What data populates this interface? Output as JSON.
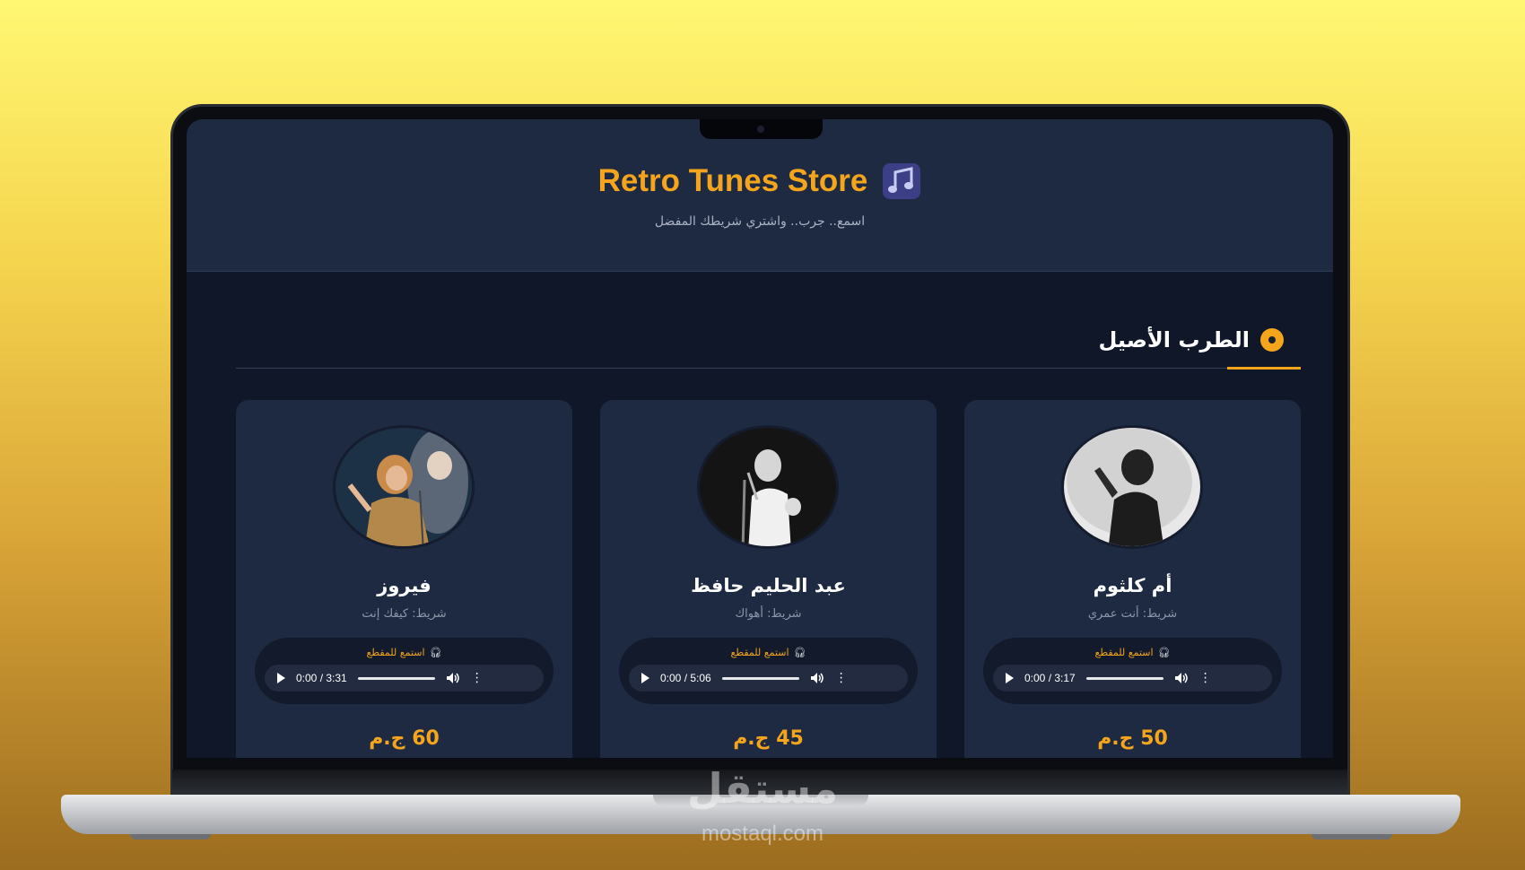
{
  "site": {
    "title": "Retro Tunes Store",
    "tagline": "اسمع.. جرب.. واشتري شريطك المفضل",
    "icon": "music-note-icon"
  },
  "section": {
    "title": "الطرب الأصيل",
    "icon": "disc-icon",
    "accent_color": "#f4a51c"
  },
  "cards": [
    {
      "artist": "أم كلثوم",
      "album": "شريط: أنت عمري",
      "listen_label": "استمع للمقطع",
      "time": "0:00 / 3:17",
      "price": "50 ج.م"
    },
    {
      "artist": "عبد الحليم حافظ",
      "album": "شريط: أهواك",
      "listen_label": "استمع للمقطع",
      "time": "0:00 / 5:06",
      "price": "45 ج.م"
    },
    {
      "artist": "فيروز",
      "album": "شريط: كيفك إنت",
      "listen_label": "استمع للمقطع",
      "time": "0:00 / 3:31",
      "price": "60 ج.م"
    }
  ],
  "watermark": {
    "logo": "مستقل",
    "url": "mostaql.com"
  }
}
